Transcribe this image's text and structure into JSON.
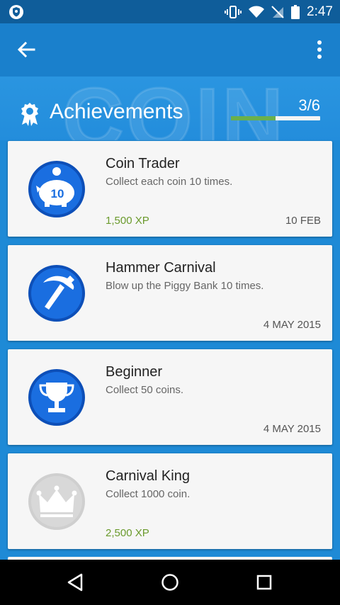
{
  "status_bar": {
    "time": "2:47"
  },
  "hero": {
    "bg_text": "COIN",
    "title": "Achievements",
    "progress_text": "3/6",
    "progress_fraction": 0.5
  },
  "colors": {
    "primary": "#1a80cc",
    "status_bar": "#0f5d9a",
    "badge_blue": "#1565d8",
    "xp_green": "#6a9a2c",
    "progress_green": "#6ab04c"
  },
  "achievements": [
    {
      "title": "Coin Trader",
      "description": "Collect each coin 10 times.",
      "xp": "1,500 XP",
      "date": "10 FEB",
      "icon": "piggy-bank-10-icon",
      "badge_number": "10",
      "unlocked": true
    },
    {
      "title": "Hammer Carnival",
      "description": "Blow up the Piggy Bank 10 times.",
      "xp": "",
      "date": "4 MAY 2015",
      "icon": "hammer-icon",
      "unlocked": true
    },
    {
      "title": "Beginner",
      "description": "Collect 50 coins.",
      "xp": "",
      "date": "4 MAY 2015",
      "icon": "trophy-icon",
      "unlocked": true
    },
    {
      "title": "Carnival King",
      "description": "Collect 1000 coin.",
      "xp": "2,500 XP",
      "date": "",
      "icon": "crown-icon",
      "unlocked": false
    }
  ]
}
